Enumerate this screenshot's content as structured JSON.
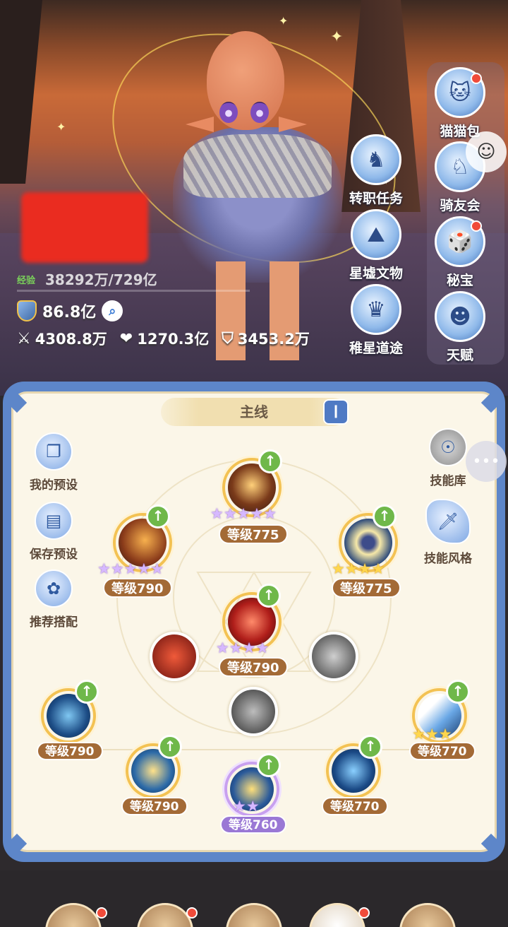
{
  "hud": {
    "exp_label": "经验",
    "exp_value": "38292万/729亿",
    "power": "86.8亿",
    "attack": "4308.8万",
    "hp": "1270.3亿",
    "defense": "3453.2万"
  },
  "feature_buttons": [
    {
      "label": "猫猫包",
      "icon": "cat-bag-icon",
      "badge": true
    },
    {
      "label": "转职任务",
      "icon": "class-change-icon",
      "badge": false
    },
    {
      "label": "骑友会",
      "icon": "horse-icon",
      "badge": false
    },
    {
      "label": "星墟文物",
      "icon": "relic-icon",
      "badge": false
    },
    {
      "label": "秘宝",
      "icon": "treasure-icon",
      "badge": true
    },
    {
      "label": "稚星道途",
      "icon": "star-path-icon",
      "badge": false
    },
    {
      "label": "天赋",
      "icon": "talent-icon",
      "badge": false
    }
  ],
  "panel": {
    "tab_title": "主线",
    "left_buttons": [
      {
        "label": "我的预设",
        "icon": "preset-cards-icon"
      },
      {
        "label": "保存预设",
        "icon": "save-icon"
      },
      {
        "label": "推荐搭配",
        "icon": "recommend-icon"
      }
    ],
    "right_buttons": [
      {
        "label": "技能库",
        "icon": "skill-library-icon"
      },
      {
        "label": "技能风格",
        "icon": "sword-style-icon"
      }
    ]
  },
  "skills": [
    {
      "level": "等级775",
      "stars": 5,
      "star_color": "purple"
    },
    {
      "level": "等级790",
      "stars": 5,
      "star_color": "purple"
    },
    {
      "level": "等级775",
      "stars": 4,
      "star_color": "gold"
    },
    {
      "level": "等级790",
      "stars": 4,
      "star_color": "purple"
    },
    {
      "level": "等级790",
      "stars": 0,
      "star_color": "none"
    },
    {
      "level": "等级790",
      "stars": 0,
      "star_color": "none"
    },
    {
      "level": "等级760",
      "stars": 2,
      "star_color": "purple"
    },
    {
      "level": "等级770",
      "stars": 0,
      "star_color": "none"
    },
    {
      "level": "等级770",
      "stars": 3,
      "star_color": "gold"
    }
  ],
  "colors": {
    "panel_blue": "#5d86c9",
    "level_brown": "#a36a36",
    "level_purple": "#9a78d5",
    "upgrade_green": "#6fb84a",
    "badge_red": "#f04b3a"
  }
}
